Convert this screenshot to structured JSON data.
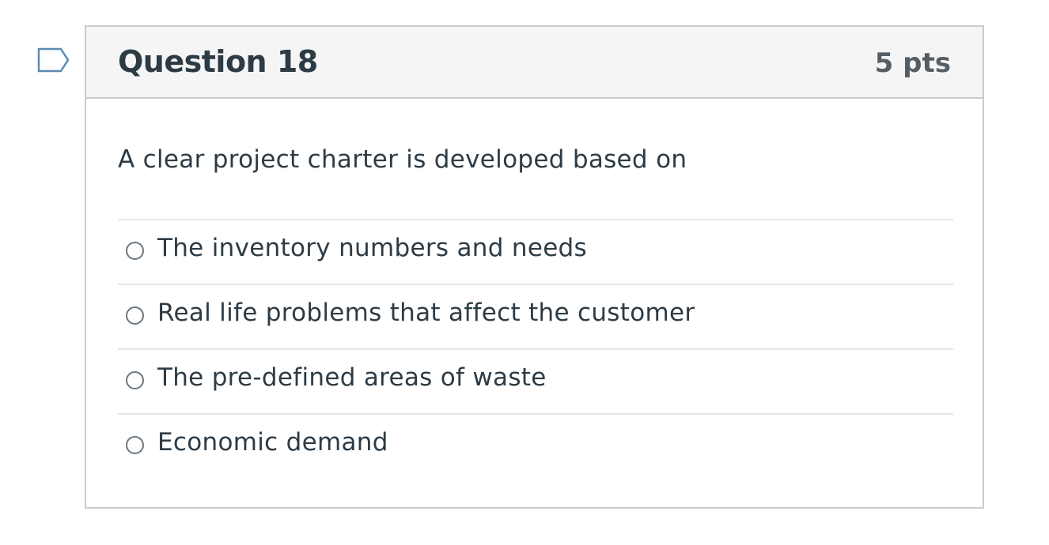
{
  "question": {
    "title": "Question 18",
    "points": "5 pts",
    "text": "A clear project charter is developed based on",
    "flag_icon": "flag-outline-icon"
  },
  "answers": [
    {
      "label": "The inventory numbers and needs",
      "selected": false
    },
    {
      "label": "Real life problems that affect the customer",
      "selected": false
    },
    {
      "label": "The pre-defined areas of waste",
      "selected": false
    },
    {
      "label": "Economic demand",
      "selected": false
    }
  ],
  "colors": {
    "flag_stroke": "#5a8bb5",
    "border": "#c7cdd1",
    "header_bg": "#f5f5f5",
    "text": "#2d3b45",
    "points_text": "#555e65",
    "divider": "#e4e6e8"
  }
}
